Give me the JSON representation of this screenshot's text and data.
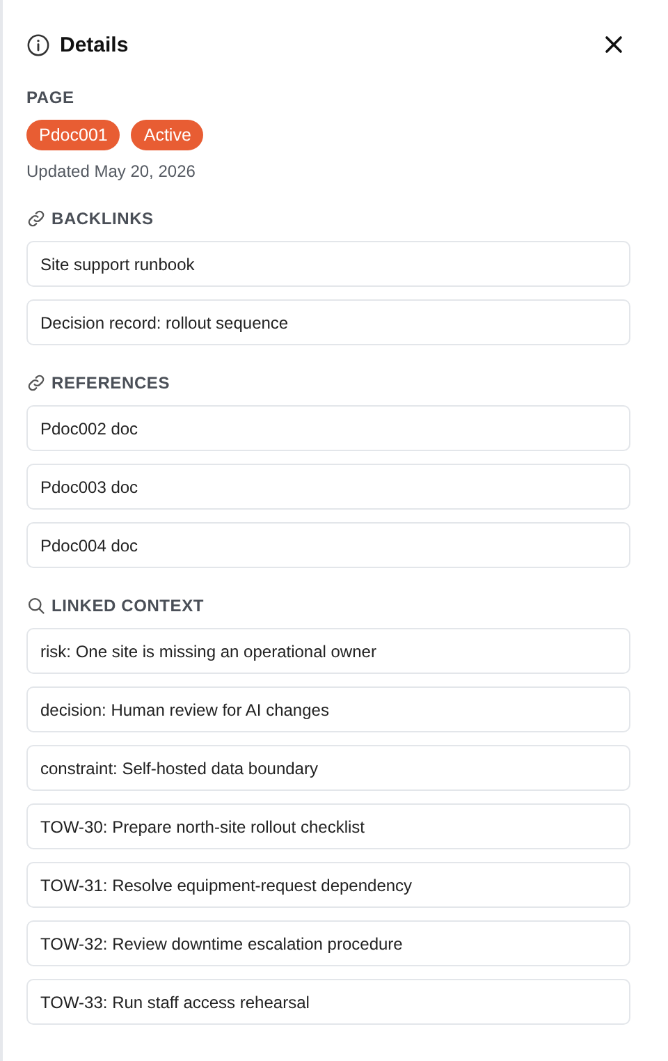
{
  "header": {
    "title": "Details"
  },
  "page": {
    "label": "PAGE",
    "badges": [
      "Pdoc001",
      "Active"
    ],
    "updated": "Updated May 20, 2026"
  },
  "sections": [
    {
      "kind": "link",
      "title": "BACKLINKS",
      "items": [
        "Site support runbook",
        "Decision record: rollout sequence"
      ]
    },
    {
      "kind": "link",
      "title": "REFERENCES",
      "items": [
        "Pdoc002 doc",
        "Pdoc003 doc",
        "Pdoc004 doc"
      ]
    },
    {
      "kind": "search",
      "title": "LINKED CONTEXT",
      "items": [
        "risk: One site is missing an operational owner",
        "decision: Human review for AI changes",
        "constraint: Self-hosted data boundary",
        "TOW-30: Prepare north-site rollout checklist",
        "TOW-31: Resolve equipment-request dependency",
        "TOW-32: Review downtime escalation procedure",
        "TOW-33: Run staff access rehearsal"
      ]
    }
  ]
}
